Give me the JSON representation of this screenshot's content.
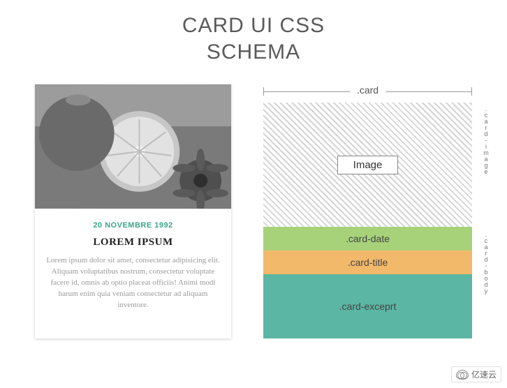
{
  "page": {
    "title_line1": "CARD UI CSS",
    "title_line2": "SCHEMA"
  },
  "card": {
    "date": "20 NOVEMBRE 1992",
    "title": "LOREM IPSUM",
    "excerpt": "Lorem ipsum dolor sit amet, consectetur adipisicing elit. Aliquam voluptatibus nostrum, consectetur voluptate facere id, omnis ab optio placeat officiis! Animi modi harum enim quia veniam consectetur ad aliquam inventore."
  },
  "schema": {
    "top_label": ".card",
    "image_label": "Image",
    "rows": {
      "date": ".card-date",
      "title": ".card-title",
      "excerpt": ".card-exceprt"
    },
    "side_labels": {
      "image": ".card-image",
      "body": ".card-body"
    },
    "colors": {
      "date": "#a8d27a",
      "title": "#f3b96b",
      "excerpt": "#5bb6a3"
    }
  },
  "watermark": {
    "text": "亿速云"
  }
}
